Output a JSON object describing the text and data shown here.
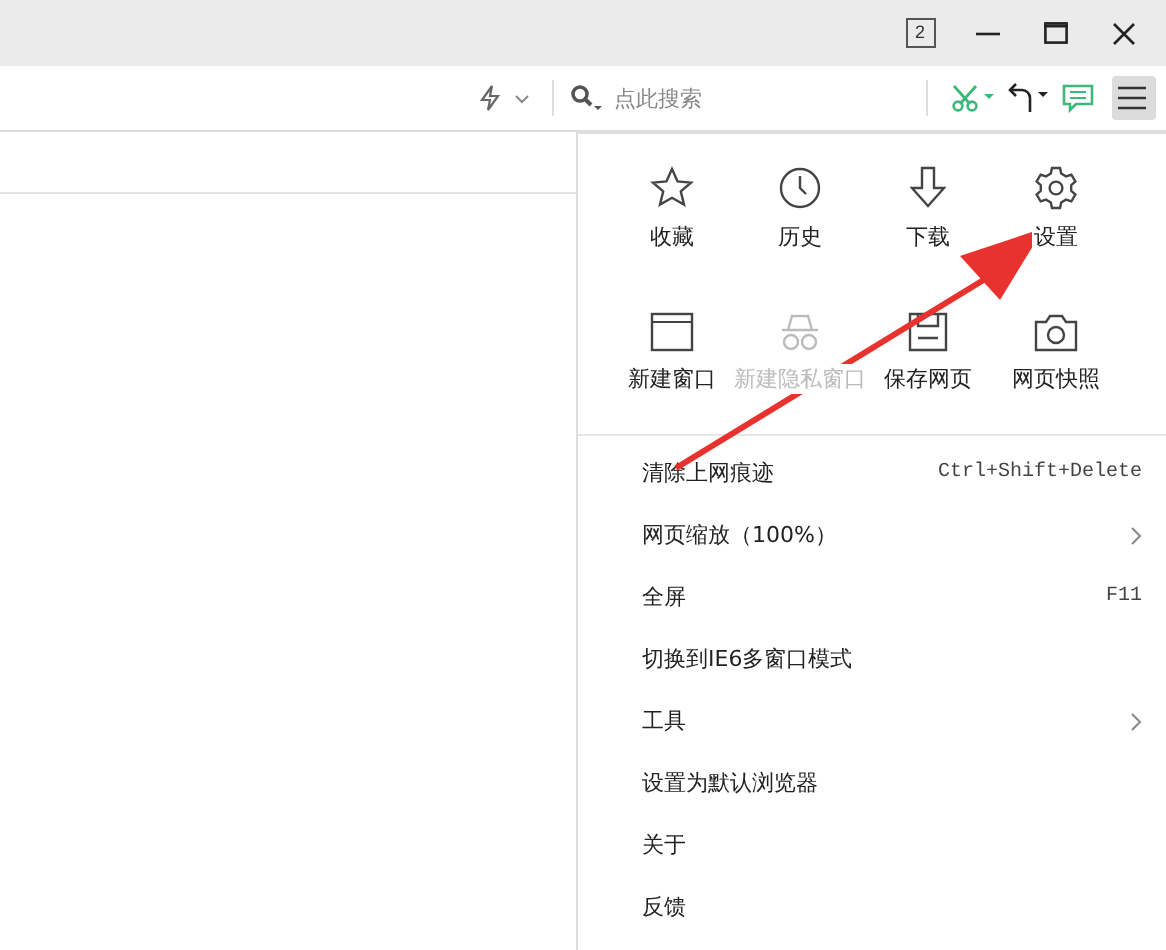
{
  "title_bar": {
    "tab_count": "2"
  },
  "toolbar": {
    "search": {
      "placeholder": "点此搜索"
    },
    "menu_open": true
  },
  "menu": {
    "grid": [
      {
        "label": "收藏",
        "disabled": false
      },
      {
        "label": "历史",
        "disabled": false
      },
      {
        "label": "下载",
        "disabled": false
      },
      {
        "label": "设置",
        "disabled": false
      },
      {
        "label": "新建窗口",
        "disabled": false
      },
      {
        "label": "新建隐私窗口",
        "disabled": true
      },
      {
        "label": "保存网页",
        "disabled": false
      },
      {
        "label": "网页快照",
        "disabled": false
      }
    ],
    "items": [
      {
        "label": "清除上网痕迹",
        "shortcut": "Ctrl+Shift+Delete",
        "submenu": false
      },
      {
        "label": "网页缩放（100%）",
        "submenu": true
      },
      {
        "label": "全屏",
        "shortcut": "F11",
        "submenu": false
      },
      {
        "label": "切换到IE6多窗口模式",
        "submenu": false
      },
      {
        "label": "工具",
        "submenu": true
      },
      {
        "label": "设置为默认浏览器",
        "submenu": false
      },
      {
        "label": "关于",
        "submenu": false
      },
      {
        "label": "反馈",
        "submenu": false
      }
    ]
  }
}
